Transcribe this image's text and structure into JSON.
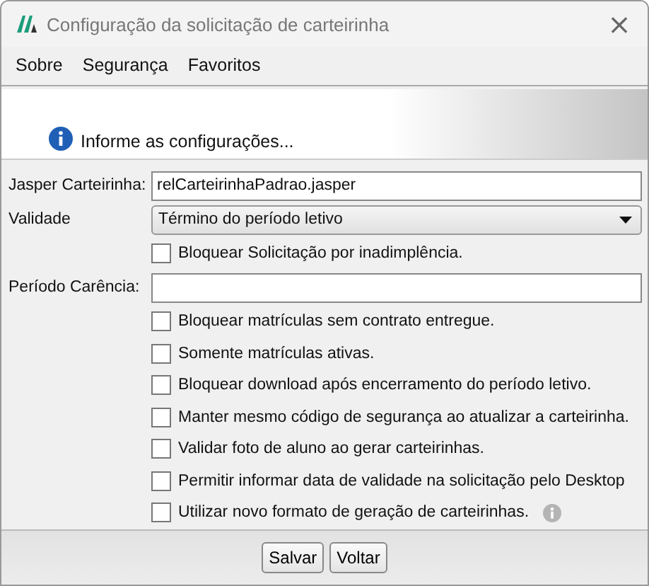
{
  "window": {
    "title": "Configuração da solicitação de carteirinha",
    "close": "×"
  },
  "menu": [
    "Sobre",
    "Segurança",
    "Favoritos"
  ],
  "banner": {
    "text": "Informe as configurações..."
  },
  "fields": [
    {
      "kind": "text",
      "label": "Jasper Carteirinha:",
      "value": "relCarteirinhaPadrao.jasper"
    },
    {
      "kind": "select",
      "label": "Validade",
      "value": "Término do período letivo"
    },
    {
      "kind": "check",
      "label": "Bloquear Solicitação por inadimplência.",
      "checked": false
    },
    {
      "kind": "text",
      "label": "Período Carência:"
    }
  ],
  "options": [
    {
      "kind": "plain",
      "label": "Bloquear matrículas sem contrato entregue.",
      "checked": false
    },
    {
      "kind": "plain",
      "label": "Somente matrículas ativas.",
      "checked": false
    },
    {
      "kind": "plain",
      "label": "Bloquear download após encerramento do período letivo.",
      "checked": false
    },
    {
      "kind": "plain",
      "label": "Manter mesmo código de segurança ao atualizar a carteirinha.",
      "checked": false
    },
    {
      "kind": "plain",
      "label": "Validar foto de aluno ao gerar carteirinhas.",
      "checked": false
    },
    {
      "kind": "plain",
      "label": "Permitir informar data de validade na solicitação pelo Desktop",
      "checked": false
    },
    {
      "kind": "info",
      "label": "Utilizar novo formato de geração de carteirinhas.",
      "checked": false
    }
  ],
  "buttons": [
    "Salvar",
    "Voltar"
  ]
}
